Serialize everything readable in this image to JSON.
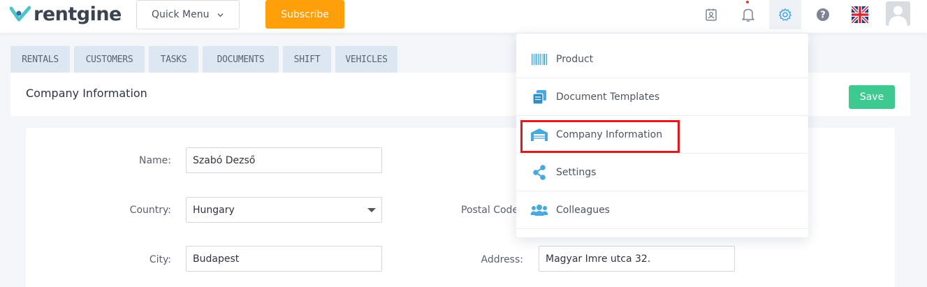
{
  "app": {
    "logo_text": "rentgine"
  },
  "topbar": {
    "quick_menu_label": "Quick Menu",
    "subscribe_label": "Subscribe"
  },
  "tabs": [
    {
      "label": "RENTALS"
    },
    {
      "label": "CUSTOMERS"
    },
    {
      "label": "TASKS"
    },
    {
      "label": "DOCUMENTS"
    },
    {
      "label": "SHIFT"
    },
    {
      "label": "VEHICLES"
    }
  ],
  "page": {
    "title": "Company Information",
    "save_label": "Save"
  },
  "form": {
    "name_label": "Name:",
    "name_value": "Szabó Dezső",
    "country_label": "Country:",
    "country_value": "Hungary",
    "postal_label": "Postal Code",
    "city_label": "City:",
    "city_value": "Budapest",
    "address_label": "Address:",
    "address_value": "Magyar Imre utca 32."
  },
  "settings_menu": {
    "items": [
      {
        "label": "Product",
        "icon": "barcode-icon"
      },
      {
        "label": "Document Templates",
        "icon": "documents-icon"
      },
      {
        "label": "Company Information",
        "icon": "warehouse-icon"
      },
      {
        "label": "Settings",
        "icon": "share-icon"
      },
      {
        "label": "Colleagues",
        "icon": "users-icon"
      }
    ]
  },
  "colors": {
    "accent_orange": "#ff9f0a",
    "save_green": "#3ec990",
    "icon_blue": "#4aa9dc",
    "highlight_red": "#e0191f"
  }
}
